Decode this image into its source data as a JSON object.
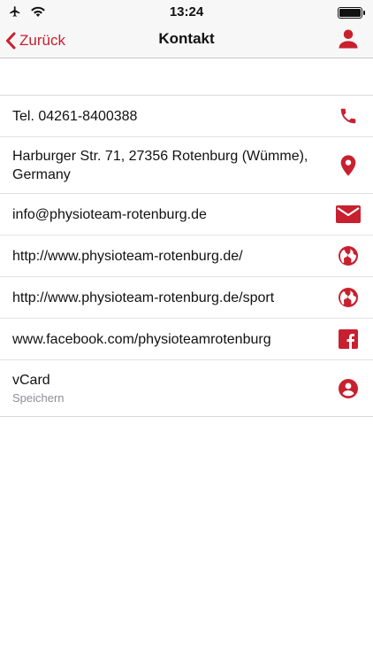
{
  "status_bar": {
    "time": "13:24"
  },
  "nav": {
    "back_label": "Zurück",
    "title": "Kontakt"
  },
  "contacts": [
    {
      "text": "Tel. 04261-8400388",
      "icon": "phone-icon"
    },
    {
      "text": "Harburger Str. 71, 27356 Rotenburg (Wümme), Germany",
      "icon": "map-pin-icon"
    },
    {
      "text": "info@physioteam-rotenburg.de",
      "icon": "mail-icon"
    },
    {
      "text": "http://www.physioteam-rotenburg.de/",
      "icon": "globe-icon"
    },
    {
      "text": "http://www.physioteam-rotenburg.de/sport",
      "icon": "globe-icon"
    },
    {
      "text": "www.facebook.com/physioteamrotenburg",
      "icon": "facebook-icon"
    },
    {
      "text": "vCard",
      "subtext": "Speichern",
      "icon": "contact-card-icon"
    }
  ],
  "colors": {
    "accent": "#c8202f",
    "background": "#ffffff",
    "separator": "#e2e2e5"
  }
}
